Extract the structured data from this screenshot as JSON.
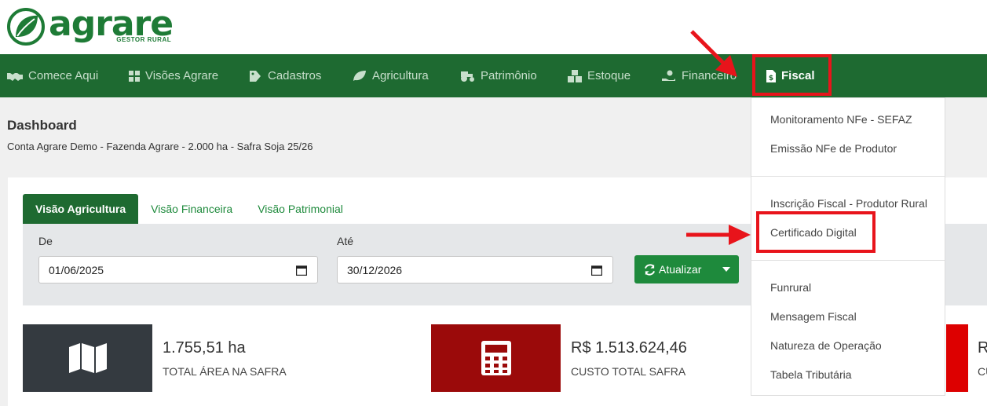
{
  "brand": {
    "name": "agrare",
    "tagline": "GESTOR RURAL",
    "color": "#1e7b36"
  },
  "nav": {
    "items": [
      {
        "label": "Comece Aqui",
        "icon": "handshake-icon"
      },
      {
        "label": "Visões Agrare",
        "icon": "grid-icon"
      },
      {
        "label": "Cadastros",
        "icon": "tag-icon"
      },
      {
        "label": "Agricultura",
        "icon": "leaf-icon"
      },
      {
        "label": "Patrimônio",
        "icon": "tractor-icon"
      },
      {
        "label": "Estoque",
        "icon": "boxes-icon"
      },
      {
        "label": "Financeiro",
        "icon": "hand-money-icon"
      },
      {
        "label": "Fiscal",
        "icon": "invoice-icon"
      }
    ]
  },
  "page": {
    "title": "Dashboard",
    "subtitle": "Conta Agrare Demo - Fazenda Agrare - 2.000 ha - Safra Soja 25/26"
  },
  "tabs": [
    {
      "label": "Visão Agricultura",
      "active": true
    },
    {
      "label": "Visão Financeira",
      "active": false
    },
    {
      "label": "Visão Patrimonial",
      "active": false
    }
  ],
  "filter": {
    "from_label": "De",
    "from_value": "01/06/2025",
    "to_label": "Até",
    "to_value": "30/12/2026",
    "update_label": "Atualizar"
  },
  "stats": [
    {
      "value": "1.755,51 ha",
      "label": "TOTAL ÁREA NA SAFRA",
      "icon": "map-icon",
      "color": "#343a40"
    },
    {
      "value": "R$ 1.513.624,46",
      "label": "CUSTO TOTAL SAFRA",
      "icon": "calculator-icon",
      "color": "#9b0a0a"
    },
    {
      "value": "R",
      "label": "CU",
      "icon": "",
      "color": "#dd0000"
    }
  ],
  "fiscal_menu": {
    "groups": [
      [
        "Monitoramento NFe - SEFAZ",
        "Emissão NFe de Produtor"
      ],
      [
        "Inscrição Fiscal - Produtor Rural",
        "Certificado Digital"
      ],
      [
        "Funrural",
        "Mensagem Fiscal",
        "Natureza de Operação",
        "Tabela Tributária"
      ]
    ]
  },
  "colors": {
    "nav_bg": "#1e6a31",
    "accent": "#1e8a3c",
    "annotation": "#e8141b"
  }
}
